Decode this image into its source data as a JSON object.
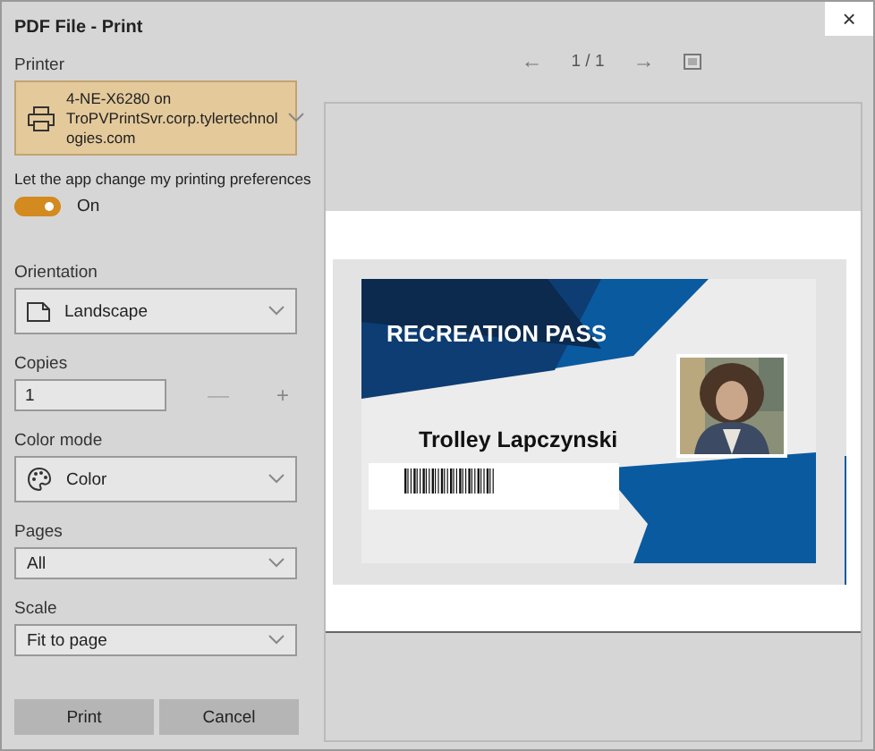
{
  "window": {
    "title": "PDF File - Print",
    "close": "×"
  },
  "printer": {
    "label": "Printer",
    "lines": [
      "4-NE-X6280 on",
      "TroPVPrintSvr.corp.tylertechnol",
      "ogies.com"
    ],
    "focused": true
  },
  "preferences": {
    "label": "Let the app change my printing preferences",
    "on": true,
    "state_text": "On"
  },
  "settings": [
    {
      "kind": "orientation",
      "label": "Orientation",
      "value": "Landscape"
    },
    {
      "kind": "copies",
      "label": "Copies",
      "value": "1",
      "minus": "—",
      "plus": "+"
    },
    {
      "kind": "color",
      "label": "Color mode",
      "value": "Color"
    },
    {
      "kind": "plain",
      "label": "Pages",
      "value": "All"
    },
    {
      "kind": "plain",
      "label": "Scale",
      "value": "Fit to page"
    }
  ],
  "buttons": [
    "Print",
    "Cancel"
  ],
  "preview": {
    "prev": "←",
    "page": "1 / 1",
    "next": "→",
    "card": {
      "title": "RECREATION PASS",
      "name": "Trolley Lapczynski"
    }
  }
}
